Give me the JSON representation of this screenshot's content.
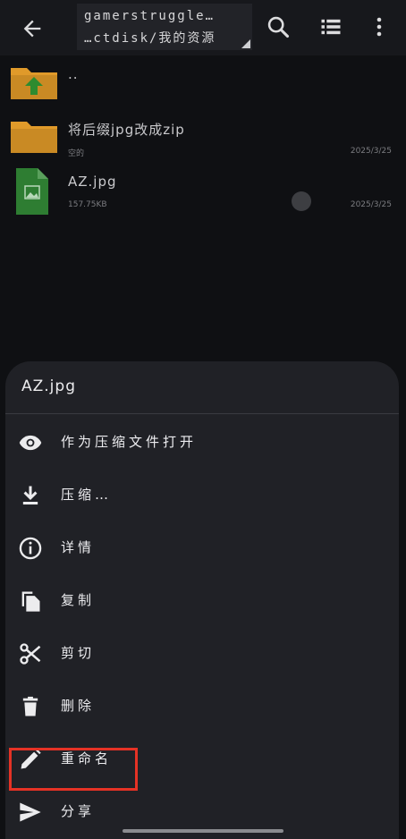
{
  "header": {
    "path_line1": "gamerstruggle…",
    "path_line2": "…ctdisk/我的资源"
  },
  "files": [
    {
      "name": "..",
      "meta": "",
      "date": "",
      "icon": "folder-up-icon"
    },
    {
      "name": "将后缀jpg改成zip",
      "meta": "空的",
      "date": "2025/3/25",
      "icon": "folder-icon"
    },
    {
      "name": "AZ.jpg",
      "meta": "157.75KB",
      "date": "2025/3/25",
      "icon": "image-file-icon"
    }
  ],
  "sheet": {
    "title": "AZ.jpg",
    "items": [
      {
        "label": "作为压缩文件打开",
        "icon": "eye-icon"
      },
      {
        "label": "压缩…",
        "icon": "download-icon"
      },
      {
        "label": "详情",
        "icon": "info-icon"
      },
      {
        "label": "复制",
        "icon": "copy-icon"
      },
      {
        "label": "剪切",
        "icon": "scissors-icon"
      },
      {
        "label": "删除",
        "icon": "trash-icon"
      },
      {
        "label": "重命名",
        "icon": "pencil-icon"
      },
      {
        "label": "分享",
        "icon": "send-icon"
      }
    ]
  },
  "colors": {
    "background": "#0f1013",
    "sheet": "#202126",
    "folder": "#e09a2a",
    "highlight": "#e53225",
    "file_green": "#2e7d32"
  }
}
